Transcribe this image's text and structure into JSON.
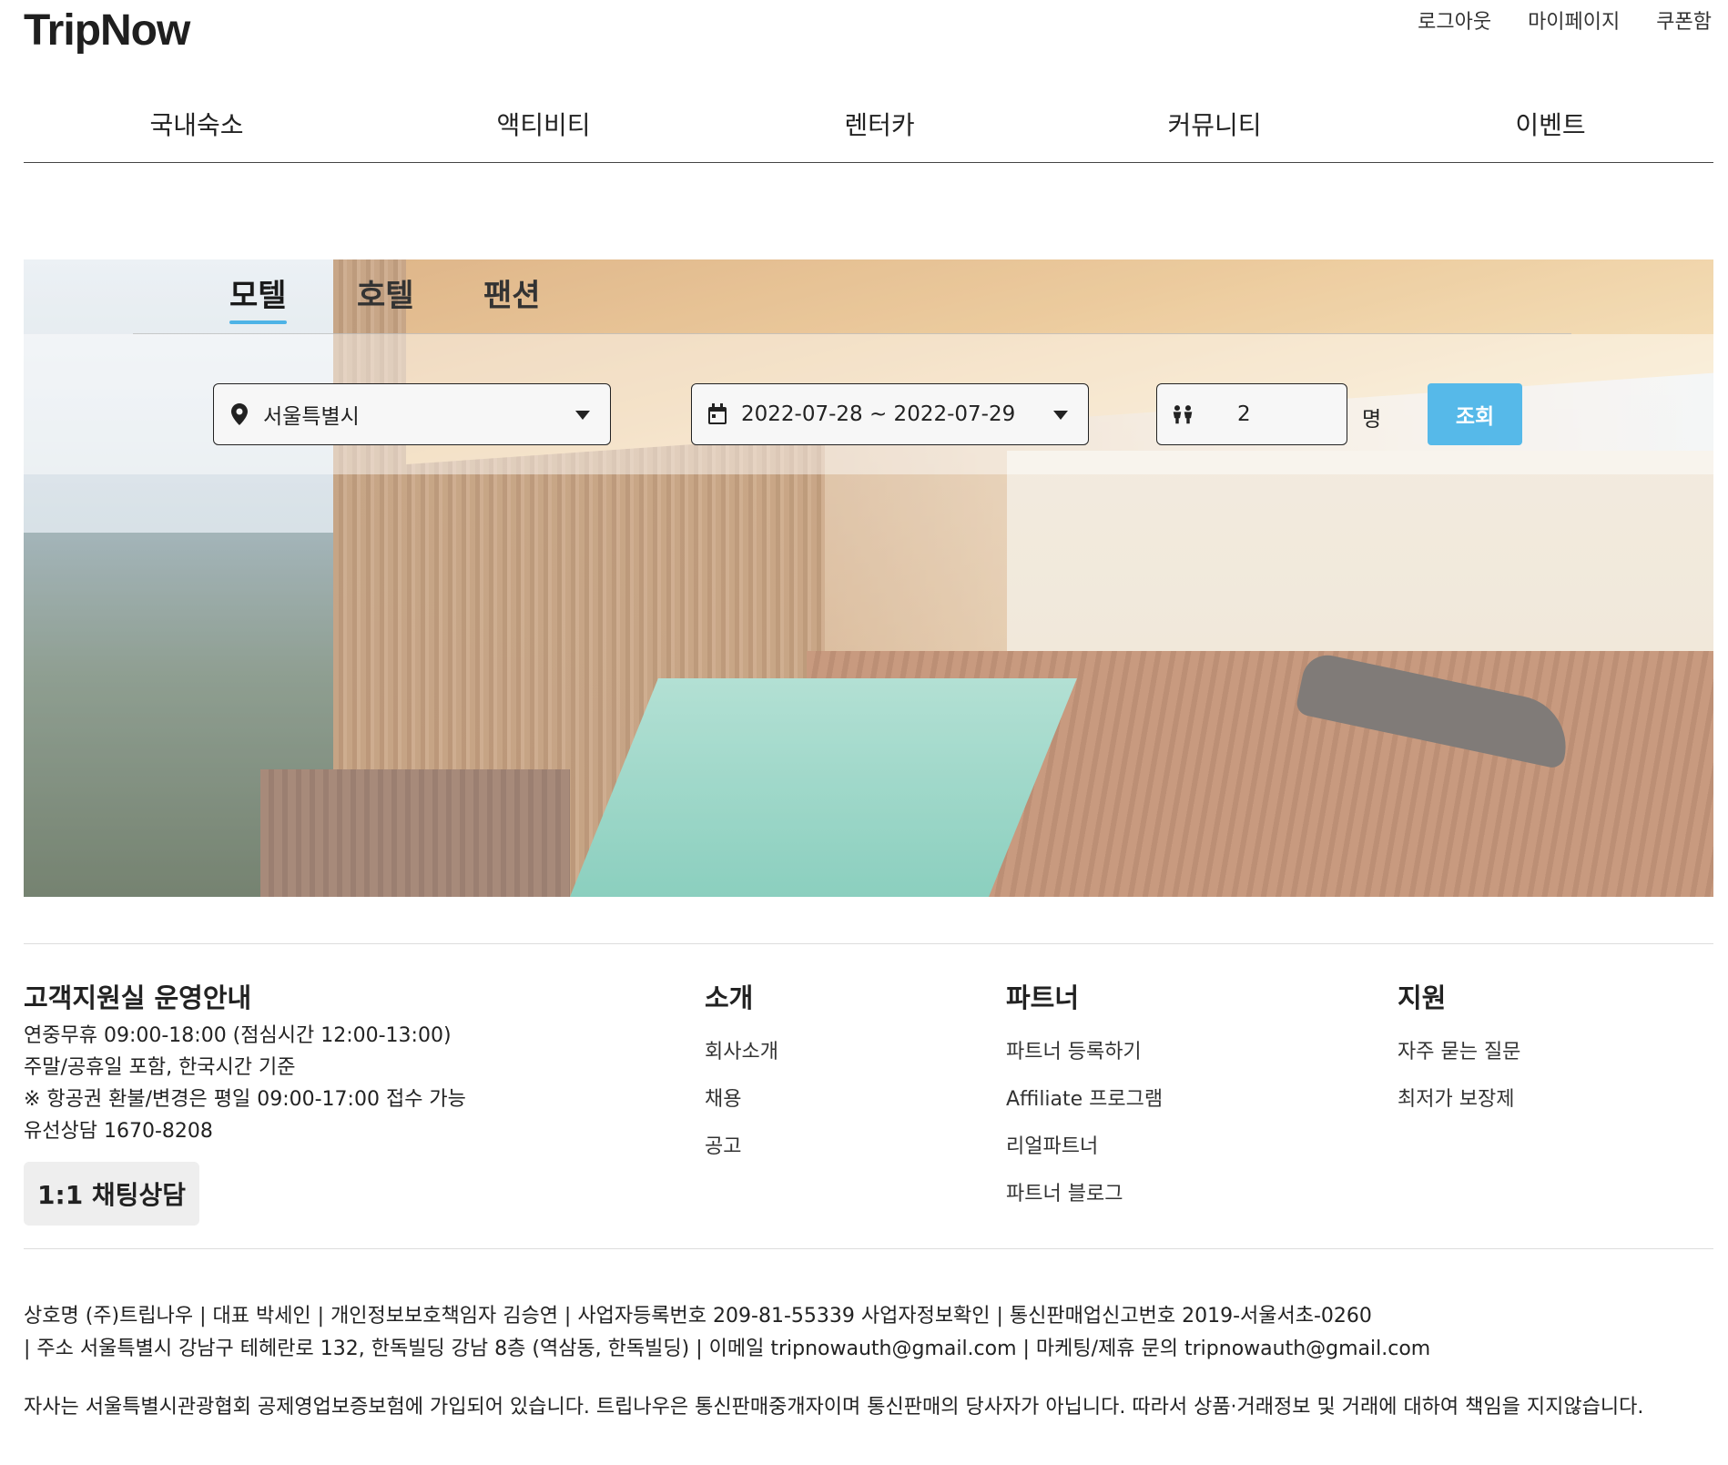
{
  "brand": "TripNow",
  "util_links": [
    "로그아웃",
    "마이페이지",
    "쿠폰함"
  ],
  "gnb": [
    "국내숙소",
    "액티비티",
    "렌터카",
    "커뮤니티",
    "이벤트"
  ],
  "search": {
    "tabs": [
      "모텔",
      "호텔",
      "팬션"
    ],
    "active_tab": "모텔",
    "region": "서울특별시",
    "dates": "2022-07-28 ~ 2022-07-29",
    "guests": "2",
    "guest_unit": "명",
    "submit_label": "조회"
  },
  "footer": {
    "support_title": "고객지원실 운영안내",
    "support_lines": [
      "연중무휴 09:00-18:00 (점심시간 12:00-13:00)",
      "주말/공휴일 포함, 한국시간 기준",
      "※ 항공권 환불/변경은 평일 09:00-17:00 접수 가능",
      "유선상담 1670-8208"
    ],
    "chat_label": "1:1 채팅상담",
    "columns": [
      {
        "title": "소개",
        "links": [
          "회사소개",
          "채용",
          "공고"
        ]
      },
      {
        "title": "파트너",
        "links": [
          "파트너 등록하기",
          "Affiliate 프로그램",
          "리얼파트너",
          "파트너 블로그"
        ]
      },
      {
        "title": "지원",
        "links": [
          "자주 묻는 질문",
          "최저가 보장제"
        ]
      }
    ],
    "business_lines": [
      "상호명 (주)트립나우 | 대표 박세인 | 개인정보보호책임자 김승연 | 사업자등록번호 209-81-55339 사업자정보확인 | 통신판매업신고번호 2019-서울서초-0260",
      "| 주소 서울특별시 강남구 테헤란로 132, 한독빌딩 강남 8층 (역삼동, 한독빌딩) | 이메일 tripnowauth@gmail.com | 마케팅/제휴 문의 tripnowauth@gmail.com"
    ],
    "notice": "자사는 서울특별시관광협회 공제영업보증보험에 가입되어 있습니다. 트립나우은 통신판매중개자이며 통신판매의 당사자가 아닙니다. 따라서 상품·거래정보 및 거래에 대하여 책임을 지지않습니다."
  },
  "icons": {
    "region": "map-pin-icon",
    "dates": "calendar-icon",
    "guests": "people-icon",
    "dropdown": "caret-down-icon"
  },
  "colors": {
    "accent": "#56b9e9",
    "tab_underline": "#4db3e6"
  }
}
